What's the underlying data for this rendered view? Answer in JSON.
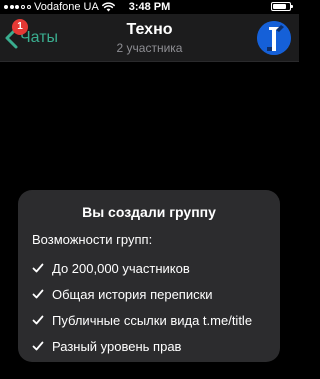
{
  "status_bar": {
    "carrier": "Vodafone UA",
    "time": "3:48 PM"
  },
  "nav": {
    "back_label": "Чаты",
    "unread_count": "1",
    "title": "Техно",
    "subtitle": "2 участника"
  },
  "card": {
    "title": "Вы создали группу",
    "subtitle": "Возможности групп:",
    "features": [
      "До 200,000 участников",
      "Общая история переписки",
      "Публичные ссылки вида t.me/title",
      "Разный уровень прав"
    ]
  },
  "colors": {
    "accent": "#3aad8f",
    "badge": "#e53935",
    "nav_background": "#1c1c1d",
    "card_background": "#2c2c2e",
    "avatar_background": "#1560d8"
  },
  "icons": {
    "signal": "signal-icon",
    "wifi": "wifi-icon",
    "battery": "battery-icon",
    "back": "chevron-left-icon",
    "avatar": "group-avatar-icon",
    "check": "check-icon"
  },
  "battery_level": 0.8
}
